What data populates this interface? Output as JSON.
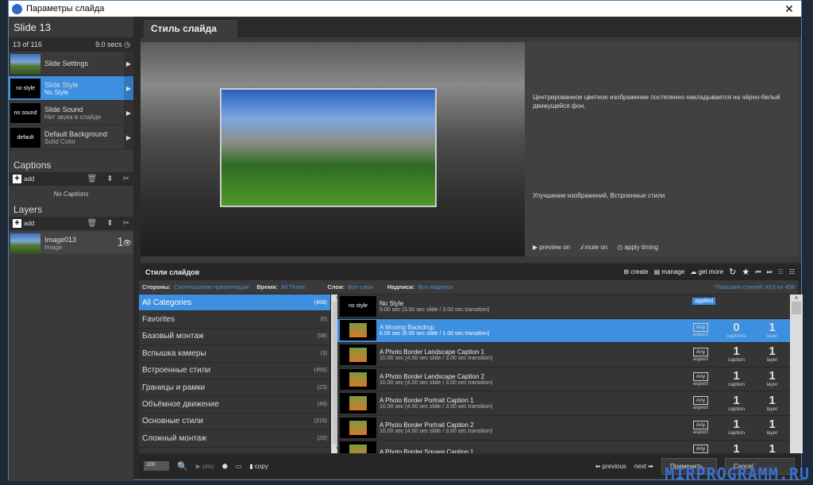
{
  "window": {
    "title": "Параметры слайда",
    "close": "✕"
  },
  "left": {
    "slide_title": "Slide 13",
    "position": "13 of 116",
    "duration": "9.0 secs",
    "items": [
      {
        "thumb": "",
        "label": "Slide Settings",
        "sub": ""
      },
      {
        "thumb": "no style",
        "label": "Slide Style",
        "sub": "No Style"
      },
      {
        "thumb": "no sound",
        "label": "Slide Sound",
        "sub": "Нет звука в слайде"
      },
      {
        "thumb": "default",
        "label": "Default Background",
        "sub": "Solid Color"
      }
    ],
    "captions_title": "Captions",
    "add": "add",
    "no_captions": "No Captions",
    "layers_title": "Layers",
    "layer": {
      "name": "Image013",
      "type": "Image",
      "number": "1"
    }
  },
  "tab": "Стиль слайда",
  "preview": {
    "description": "Центрированное цветное изображение постепенно накладывается на чёрно-белый движущейся фон.",
    "tags": "Улучшение изображений, Встроенные стили",
    "preview_on": "preview on",
    "mute_on": "mute on",
    "apply_timing": "apply timing"
  },
  "styles": {
    "title": "Стили слайдов",
    "toolbar": {
      "create": "create",
      "manage": "manage",
      "get_more": "get more"
    },
    "filter": {
      "sides_label": "Стороны:",
      "sides_value": "Соотношение презентации",
      "time_label": "Время:",
      "time_value": "All Times",
      "layers_label": "Слои:",
      "layers_value": "Все слои",
      "captions_label": "Надписи:",
      "captions_value": "Все надписи",
      "shown": "Показано стилей: 419 из 458"
    },
    "categories": [
      {
        "name": "All Categories",
        "count": "(458)"
      },
      {
        "name": "Favorites",
        "count": "(0)"
      },
      {
        "name": "Базовый монтаж",
        "count": "(58)"
      },
      {
        "name": "Вспышка камеры",
        "count": "(3)"
      },
      {
        "name": "Встроенные стили",
        "count": "(458)"
      },
      {
        "name": "Границы и рамки",
        "count": "(23)"
      },
      {
        "name": "Объёмное движение",
        "count": "(49)"
      },
      {
        "name": "Основные стили",
        "count": "(215)"
      },
      {
        "name": "Сложный монтаж",
        "count": "(20)"
      }
    ],
    "list": [
      {
        "name": "No Style",
        "sub": "9.00 sec (3.00 sec slide / 3.00 sec transition)",
        "badge": "applied"
      },
      {
        "name": "A Moving Backdrop",
        "sub": "8.00 sec (6.00 sec slide / 1.00 sec transition)",
        "aspect": "Any",
        "aspect_label": "aspect",
        "captions": "0",
        "captions_label": "captions",
        "layers": "1",
        "layers_label": "layer"
      },
      {
        "name": "A Photo Border Landscape Caption 1",
        "sub": "10.00 sec (4.00 sec slide / 3.00 sec transition)",
        "aspect": "Any",
        "aspect_label": "aspect",
        "captions": "1",
        "captions_label": "caption",
        "layers": "1",
        "layers_label": "layer"
      },
      {
        "name": "A Photo Border Landscape Caption 2",
        "sub": "10.00 sec (4.00 sec slide / 3.00 sec transition)",
        "aspect": "Any",
        "aspect_label": "aspect",
        "captions": "1",
        "captions_label": "caption",
        "layers": "1",
        "layers_label": "layer"
      },
      {
        "name": "A Photo Border Portrait Caption 1",
        "sub": "10.00 sec (4.00 sec slide / 3.00 sec transition)",
        "aspect": "Any",
        "aspect_label": "aspect",
        "captions": "1",
        "captions_label": "caption",
        "layers": "1",
        "layers_label": "layer"
      },
      {
        "name": "A Photo Border Portrait Caption 2",
        "sub": "10.00 sec (4.00 sec slide / 3.00 sec transition)",
        "aspect": "Any",
        "aspect_label": "aspect",
        "captions": "1",
        "captions_label": "caption",
        "layers": "1",
        "layers_label": "layer"
      },
      {
        "name": "A Photo Border Square Caption 1",
        "sub": "",
        "aspect": "Any",
        "aspect_label": "aspect",
        "captions": "1",
        "captions_label": "caption",
        "layers": "1",
        "layers_label": "layer"
      }
    ]
  },
  "bottom": {
    "zoom": "100",
    "play": "play",
    "copy": "copy",
    "previous": "previous",
    "next": "next",
    "apply": "Применить...",
    "cancel": "Cancel"
  },
  "watermark": "MIRPROGRAMM.RU",
  "colors": {
    "accent": "#3d8fe0",
    "link": "#4d8fd8"
  }
}
